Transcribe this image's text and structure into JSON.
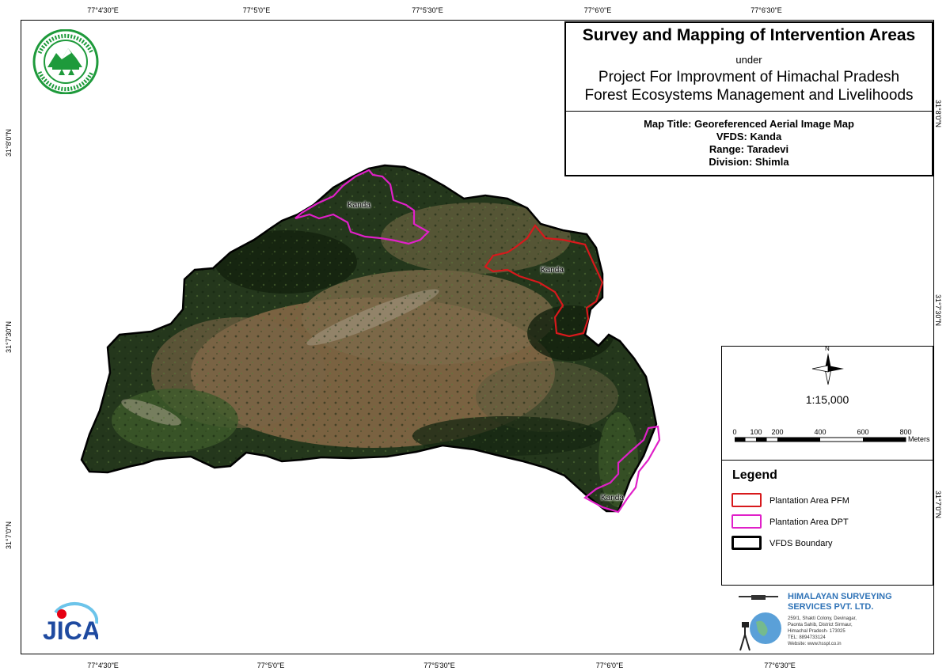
{
  "graticule": {
    "top": [
      "77°4'30\"E",
      "77°5'0\"E",
      "77°5'30\"E",
      "77°6'0\"E",
      "77°6'30\"E"
    ],
    "bottom": [
      "77°4'30\"E",
      "77°5'0\"E",
      "77°5'30\"E",
      "77°6'0\"E",
      "77°6'30\"E"
    ],
    "left": [
      "31°8'0\"N",
      "31°7'30\"N",
      "31°7'0\"N"
    ],
    "right": [
      "31°8'0\"N",
      "31°7'30\"N",
      "31°7'0\"N"
    ]
  },
  "title": {
    "main": "Survey and Mapping of Intervention Areas",
    "under": "under",
    "project_line1": "Project For Improvment of Himachal Pradesh",
    "project_line2": "Forest Ecosystems Management and Livelihoods"
  },
  "meta": {
    "map_title": "Map Title: Georeferenced Aerial Image Map",
    "vfds": "VFDS: Kanda",
    "range": "Range: Taradevi",
    "division": "Division: Shimla"
  },
  "map_labels": [
    "Kanda",
    "Kanda",
    "Kanda"
  ],
  "north_arrow": "N",
  "scale": {
    "ratio": "1:15,000",
    "ticks": [
      "0",
      "100",
      "200",
      "400",
      "600",
      "800"
    ],
    "unit": "Meters"
  },
  "legend": {
    "title": "Legend",
    "items": [
      {
        "label": "Plantation Area PFM",
        "color": "#d7191c"
      },
      {
        "label": "Plantation Area DPT",
        "color": "#e020c8"
      },
      {
        "label": "VFDS Boundary",
        "color": "#000000"
      }
    ]
  },
  "company": {
    "name": "HIMALAYAN SURVEYING SERVICES PVT. LTD.",
    "address": [
      "259/1, Shakti Colony, Devinagar,",
      "Paonta Sahib, District Sirmaur,",
      "Himachal Pradesh- 173025",
      "TEL: 8894733124",
      "Website: www.hsspl.co.in"
    ]
  },
  "logos": {
    "emblem_text": "वन ही जल, जीवन व जीविका / वन विभाग हिमाचल प्रदेश",
    "jica": "JICA"
  },
  "colors": {
    "pfm": "#d7191c",
    "dpt": "#e020c8",
    "boundary": "#000000",
    "forest_dark": "#1f3318",
    "forest_mid": "#3d5a2a",
    "terrain_brown": "#8a6a48",
    "company_blue": "#2f73b7",
    "jica_blue": "#1f4aa0",
    "jica_red": "#e60012"
  }
}
